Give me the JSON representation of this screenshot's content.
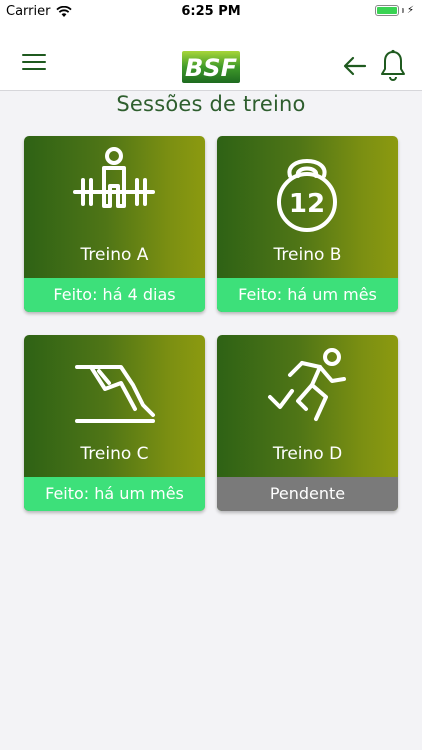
{
  "status_bar": {
    "carrier": "Carrier",
    "time": "6:25 PM"
  },
  "header": {
    "logo_text": "BSF"
  },
  "page": {
    "title": "Sessões de treino"
  },
  "sessions": [
    {
      "label": "Treino A",
      "status": "Feito: há 4 dias",
      "state": "done",
      "icon": "barbell-lifter-icon"
    },
    {
      "label": "Treino B",
      "status": "Feito: há um mês",
      "state": "done",
      "icon": "kettlebell-12-icon",
      "icon_text": "12"
    },
    {
      "label": "Treino C",
      "status": "Feito: há um mês",
      "state": "done",
      "icon": "stretching-icon"
    },
    {
      "label": "Treino D",
      "status": "Pendente",
      "state": "pending",
      "icon": "running-icon"
    }
  ],
  "colors": {
    "brand_green": "#2e5e2e",
    "done": "#3de07a",
    "pending": "#7a7a7a",
    "card_gradient_start": "#2e6215",
    "card_gradient_end": "#8c9a10"
  }
}
